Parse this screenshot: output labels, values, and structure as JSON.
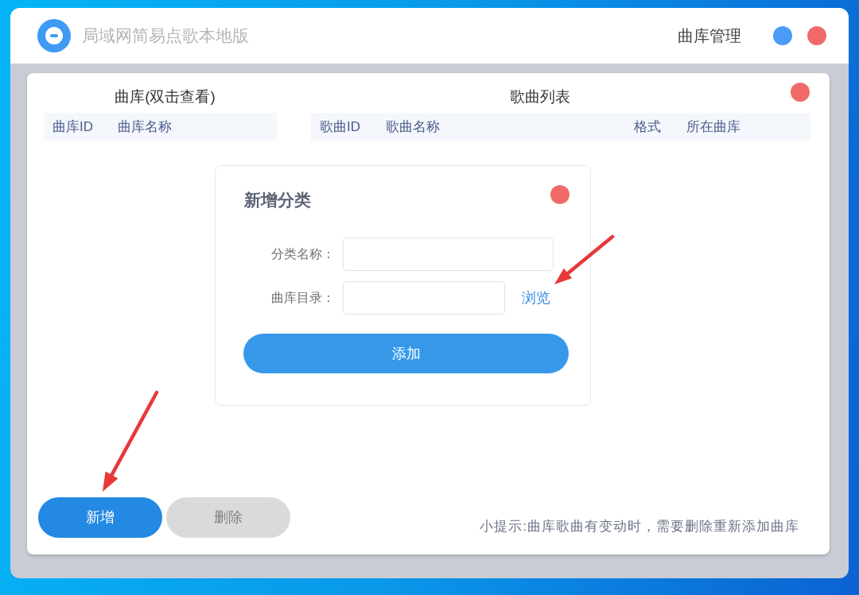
{
  "window": {
    "title": "局域网简易点歌本地版",
    "menu": "曲库管理"
  },
  "library_panel": {
    "title": "曲库(双击查看)",
    "columns": [
      "曲库ID",
      "曲库名称"
    ]
  },
  "song_panel": {
    "title": "歌曲列表",
    "columns": [
      "歌曲ID",
      "歌曲名称",
      "格式",
      "所在曲库"
    ]
  },
  "dialog": {
    "title": "新增分类",
    "fields": [
      {
        "label": "分类名称："
      },
      {
        "label": "曲库目录：",
        "button": "浏览"
      }
    ],
    "submit": "添加"
  },
  "actions": [
    {
      "label": "新增",
      "disabled": false
    },
    {
      "label": "删除",
      "disabled": true
    }
  ],
  "hint": "小提示:曲库歌曲有变动时，需要删除重新添加曲库"
}
